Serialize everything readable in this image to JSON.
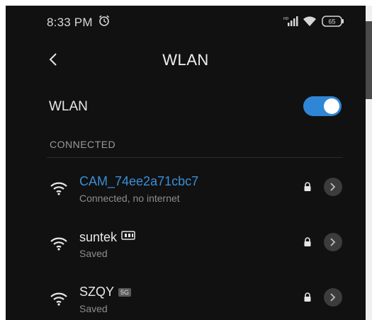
{
  "status_bar": {
    "time": "8:33 PM",
    "battery": "65"
  },
  "header": {
    "title": "WLAN"
  },
  "wlan_toggle": {
    "label": "WLAN",
    "enabled": true,
    "accent_color": "#2f86d6"
  },
  "section": {
    "connected_header": "CONNECTED"
  },
  "networks": [
    {
      "name": "CAM_74ee2a71cbc7",
      "status": "Connected, no internet",
      "connected": true,
      "secured": true,
      "badge": ""
    },
    {
      "name": "suntek",
      "status": "Saved",
      "connected": false,
      "secured": true,
      "badge": "router-icon"
    },
    {
      "name": "SZQY",
      "status": "Saved",
      "connected": false,
      "secured": true,
      "badge": "5G"
    }
  ]
}
